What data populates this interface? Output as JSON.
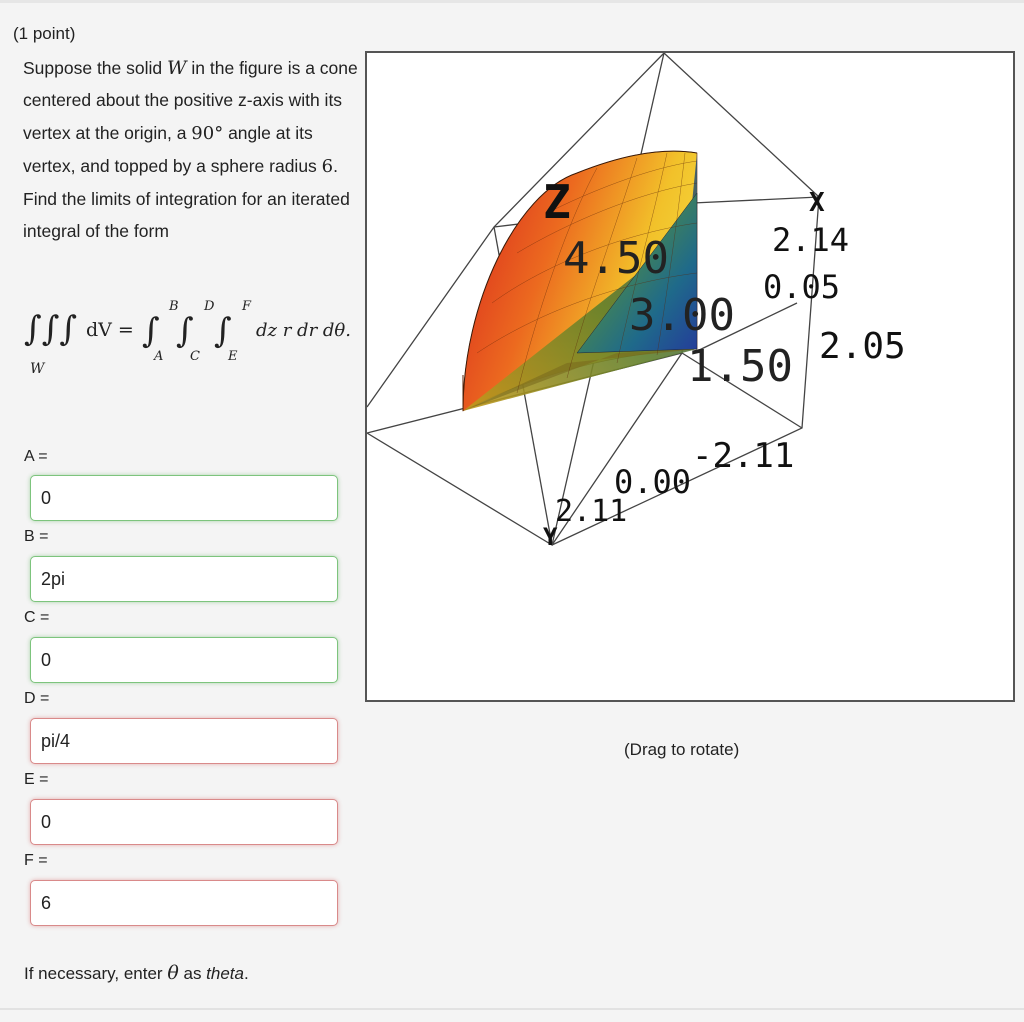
{
  "problem": {
    "points": "(1 point)",
    "text_1": "Suppose the solid ",
    "var_W": "W",
    "text_2": " in the figure is a cone centered about the positive z-axis with its vertex at the origin, a ",
    "angle": "90°",
    "text_3": " angle at its vertex, and topped by a sphere radius ",
    "radius": "6",
    "text_4": ". Find the limits of integration for an iterated integral of the form"
  },
  "formula": {
    "integrand": "dV =",
    "region": "W",
    "upper_limits": [
      "B",
      "D",
      "F"
    ],
    "lower_limits": [
      "A",
      "C",
      "E"
    ],
    "differentials": "dz r dr dθ."
  },
  "answers": [
    {
      "label": "A =",
      "value": "0",
      "status": "correct"
    },
    {
      "label": "B =",
      "value": "2pi",
      "status": "correct"
    },
    {
      "label": "C =",
      "value": "0",
      "status": "correct"
    },
    {
      "label": "D =",
      "value": "pi/4",
      "status": "incorrect"
    },
    {
      "label": "E =",
      "value": "0",
      "status": "incorrect"
    },
    {
      "label": "F =",
      "value": "6",
      "status": "incorrect"
    }
  ],
  "note": {
    "text_1": "If necessary, enter ",
    "symbol": "θ",
    "text_2": " as ",
    "keyword": "theta",
    "text_3": "."
  },
  "graph": {
    "caption": "(Drag to rotate)",
    "axis_labels": {
      "z": "Z",
      "x": "X",
      "y": "Y"
    },
    "tick_labels": {
      "z1": "4.50",
      "z2": "3.00",
      "z3": "1.50",
      "x1": "2.14",
      "x2": "0.05",
      "x3": "2.05",
      "y1": "-2.11",
      "y2": "0.00",
      "y3": "2.11"
    }
  },
  "colors": {
    "correct_border": "#7dc47d",
    "incorrect_border": "#d98a8a"
  }
}
